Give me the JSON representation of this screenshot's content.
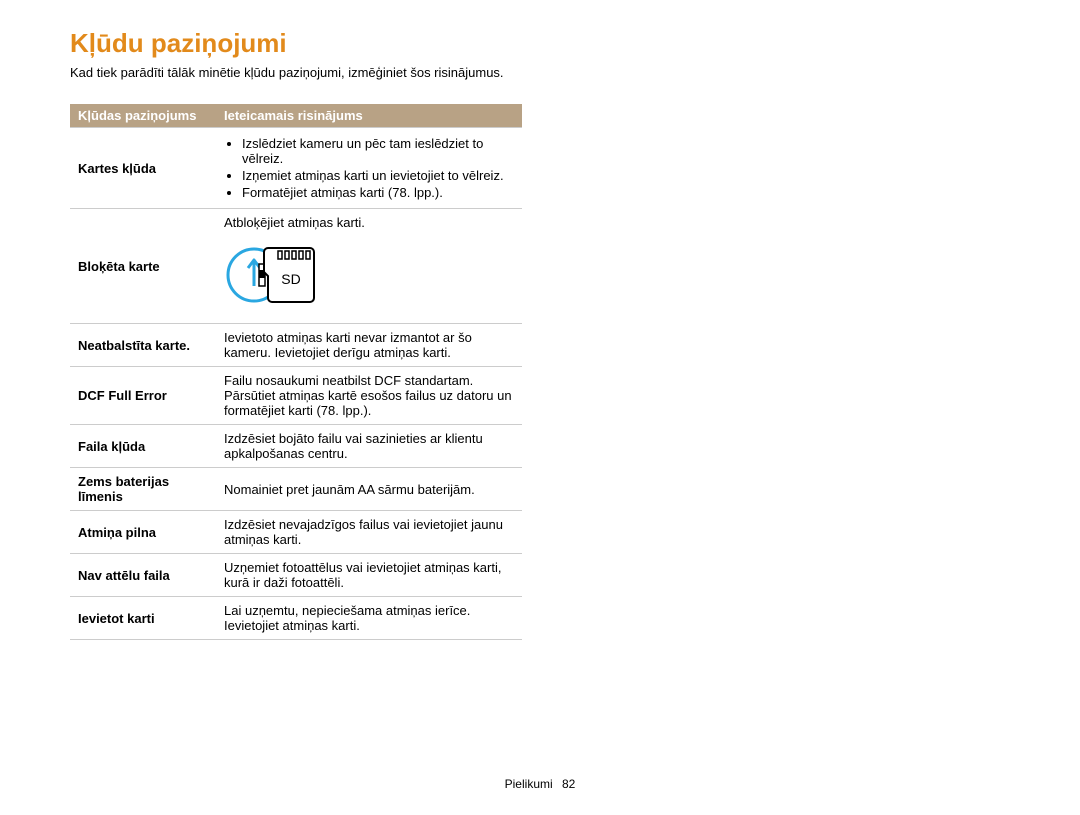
{
  "title": "Kļūdu paziņojumi",
  "intro": "Kad tiek parādīti tālāk minētie kļūdu paziņojumi, izmēģiniet šos risinājumus.",
  "table": {
    "headers": {
      "col0": "Kļūdas paziņojums",
      "col1": "Ieteicamais risinājums"
    },
    "rows": {
      "r0": {
        "label": "Kartes kļūda",
        "bullets": [
          "Izslēdziet kameru un pēc tam ieslēdziet to vēlreiz.",
          "Izņemiet atmiņas karti un ievietojiet to vēlreiz.",
          "Formatējiet atmiņas karti (78. lpp.)."
        ]
      },
      "r1": {
        "label": "Bloķēta karte",
        "text": "Atbloķējiet atmiņas karti.",
        "sd_label": "SD"
      },
      "r2": {
        "label": "Neatbalstīta karte.",
        "text": "Ievietoto atmiņas karti nevar izmantot ar šo kameru. Ievietojiet derīgu atmiņas karti."
      },
      "r3": {
        "label": "DCF Full Error",
        "text": "Failu nosaukumi neatbilst DCF standartam. Pārsūtiet atmiņas kartē esošos failus uz datoru un formatējiet karti (78. lpp.)."
      },
      "r4": {
        "label": "Faila kļūda",
        "text": "Izdzēsiet bojāto failu vai sazinieties ar klientu apkalpošanas centru."
      },
      "r5": {
        "label": "Zems baterijas līmenis",
        "text": "Nomainiet pret jaunām AA sārmu baterijām."
      },
      "r6": {
        "label": "Atmiņa pilna",
        "text": "Izdzēsiet nevajadzīgos failus vai ievietojiet jaunu atmiņas karti."
      },
      "r7": {
        "label": "Nav attēlu faila",
        "text": "Uzņemiet fotoattēlus vai ievietojiet atmiņas karti, kurā ir daži fotoattēli."
      },
      "r8": {
        "label": "Ievietot karti",
        "text": "Lai uzņemtu, nepieciešama atmiņas ierīce. Ievietojiet atmiņas karti."
      }
    }
  },
  "footer": {
    "section": "Pielikumi",
    "page": "82"
  }
}
